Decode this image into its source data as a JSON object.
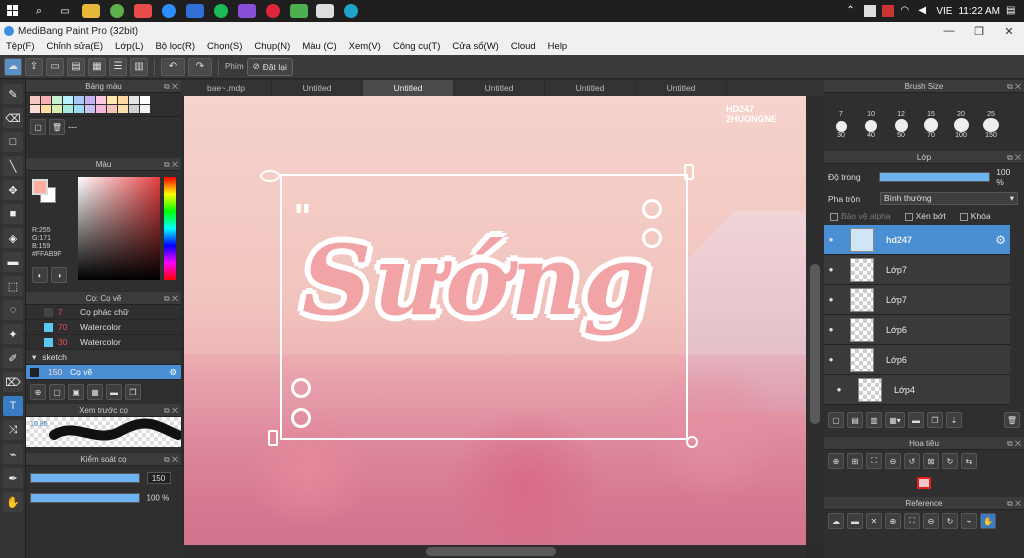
{
  "taskbar": {
    "tray_lang": "VIE",
    "clock": "11:22 AM"
  },
  "window": {
    "title": "MediBang Paint Pro (32bit)"
  },
  "menu": [
    "Tệp(F)",
    "Chỉnh sửa(E)",
    "Lớp(L)",
    "Bộ lọc(R)",
    "Chọn(S)",
    "Chụp(N)",
    "Màu (C)",
    "Xem(V)",
    "Công cụ(T)",
    "Cửa sổ(W)",
    "Cloud",
    "Help"
  ],
  "toolbar": {
    "shortcut_label": "Phím",
    "reset_label": "Đặt lại"
  },
  "left": {
    "palette_title": "Bảng màu",
    "palette_footer": "---",
    "color_title": "Màu",
    "color_rgb": [
      "R:255",
      "G:171",
      "B:159",
      "#FFAB9F"
    ],
    "brush_title": "Cọ: Cọ vẽ",
    "brushes": [
      {
        "size": "7",
        "name": "Cọ phác chữ",
        "color": "#444444"
      },
      {
        "size": "70",
        "name": "Watercolor",
        "color": "#5bc8f2"
      },
      {
        "size": "30",
        "name": "Watercolor",
        "color": "#5bc8f2"
      }
    ],
    "brush_group": "sketch",
    "brush_selected": {
      "size": "150",
      "name": "Cọ vẽ"
    },
    "preview_title": "Xem trước cọ",
    "preview_size": "10.85",
    "control_title": "Kiểm soát cọ",
    "control_size": "150",
    "control_opacity": "100 %",
    "control_size_fraction": 1.0,
    "control_opacity_fraction": 1.0
  },
  "tabs": [
    "bae~.mdp",
    "Untitled",
    "Untitled",
    "Untitled",
    "Untitled",
    "Untitled"
  ],
  "active_tab": 2,
  "canvas": {
    "watermark_1": "HD247",
    "watermark_2": "2HUONGNE",
    "art_word": "Sướng"
  },
  "right": {
    "brush_size_title": "Brush Size",
    "sizes_row1": [
      "7",
      "10",
      "12",
      "15",
      "20",
      "25"
    ],
    "sizes_row2": [
      "30",
      "40",
      "50",
      "70",
      "100",
      "150"
    ],
    "layer_title": "Lớp",
    "opacity_label": "Độ trong",
    "opacity_value": "100 %",
    "opacity_fraction": 1.0,
    "blend_label": "Pha trộn",
    "blend_value": "Bình thường",
    "protect_alpha": "Bảo vệ alpha",
    "clip_label": "Xén bớt",
    "lock_label": "Khóa",
    "layers": [
      {
        "name": "hd247",
        "selected": true
      },
      {
        "name": "Lớp7",
        "selected": false
      },
      {
        "name": "Lớp7",
        "selected": false
      },
      {
        "name": "Lớp6",
        "selected": false
      },
      {
        "name": "Lớp6",
        "selected": false
      },
      {
        "name": "Lớp4",
        "selected": false
      }
    ],
    "navigator_title": "Hoa tiêu",
    "reference_title": "Reference"
  }
}
